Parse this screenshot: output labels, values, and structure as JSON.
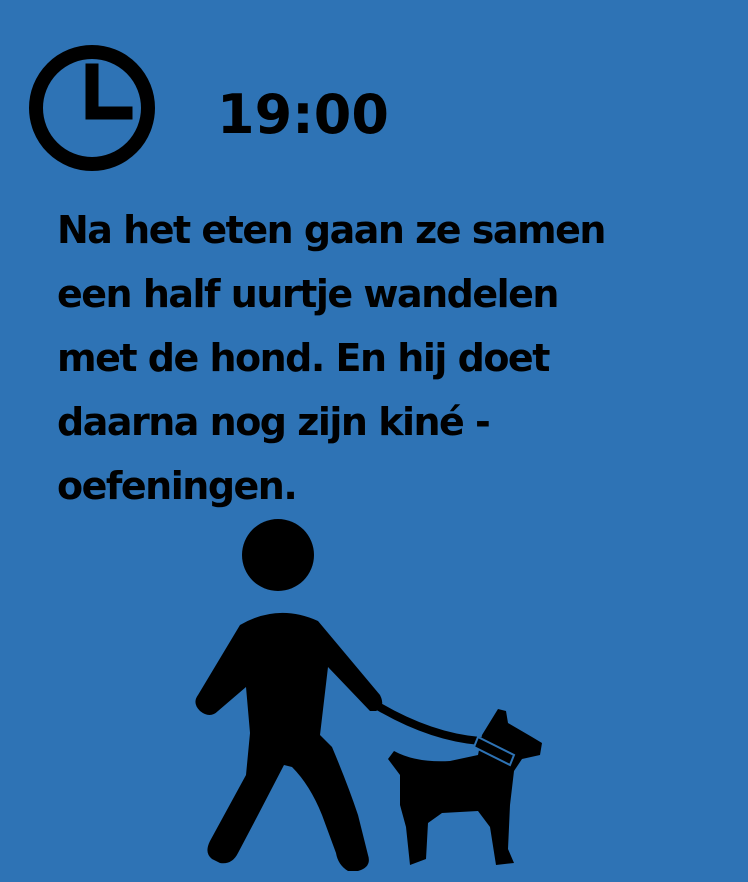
{
  "colors": {
    "background": "#2e73b5",
    "ink": "#000000"
  },
  "header": {
    "icon": "clock-icon",
    "time": "19:00"
  },
  "story": {
    "lines": [
      "Na het eten gaan ze samen",
      "een half uurtje wandelen",
      "met de hond. En hij doet",
      "daarna nog zijn kiné -",
      "oefeningen."
    ]
  },
  "illustration": {
    "icon": "person-walking-dog-icon"
  }
}
